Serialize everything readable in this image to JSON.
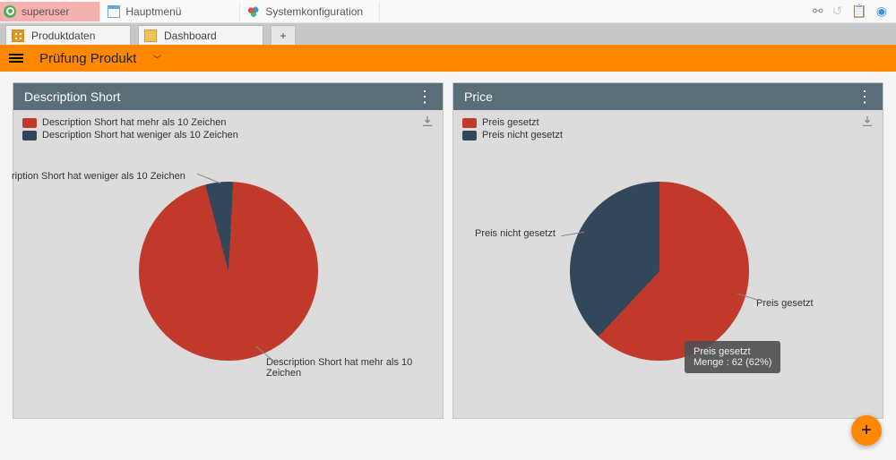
{
  "topbar": {
    "user": "superuser",
    "tabs": [
      {
        "label": "Hauptmenü"
      },
      {
        "label": "Systemkonfiguration"
      }
    ]
  },
  "workspace_tabs": [
    {
      "label": "Produktdaten"
    },
    {
      "label": "Dashboard"
    }
  ],
  "page_title": "Prüfung Produkt",
  "cards": {
    "left": {
      "title": "Description Short",
      "legend": [
        "Description Short hat mehr als 10 Zeichen",
        "Description Short hat weniger als 10 Zeichen"
      ],
      "label_tr": "ription Short hat weniger als 10 Zeichen",
      "label_main": "Description Short hat mehr als 10 Zeichen"
    },
    "right": {
      "title": "Price",
      "legend": [
        "Preis gesetzt",
        "Preis nicht gesetzt"
      ],
      "label_dark": "Preis nicht gesetzt",
      "label_red": "Preis gesetzt",
      "tooltip_l1": "Preis gesetzt",
      "tooltip_l2": "Menge : 62 (62%)"
    }
  },
  "chart_data": [
    {
      "type": "pie",
      "title": "Description Short",
      "categories": [
        "Description Short hat mehr als 10 Zeichen",
        "Description Short hat weniger als 10 Zeichen"
      ],
      "values": [
        95,
        5
      ]
    },
    {
      "type": "pie",
      "title": "Price",
      "categories": [
        "Preis gesetzt",
        "Preis nicht gesetzt"
      ],
      "values": [
        62,
        38
      ]
    }
  ],
  "colors": {
    "red": "#c0392b",
    "dark": "#33475a",
    "accent": "#ff8800"
  }
}
